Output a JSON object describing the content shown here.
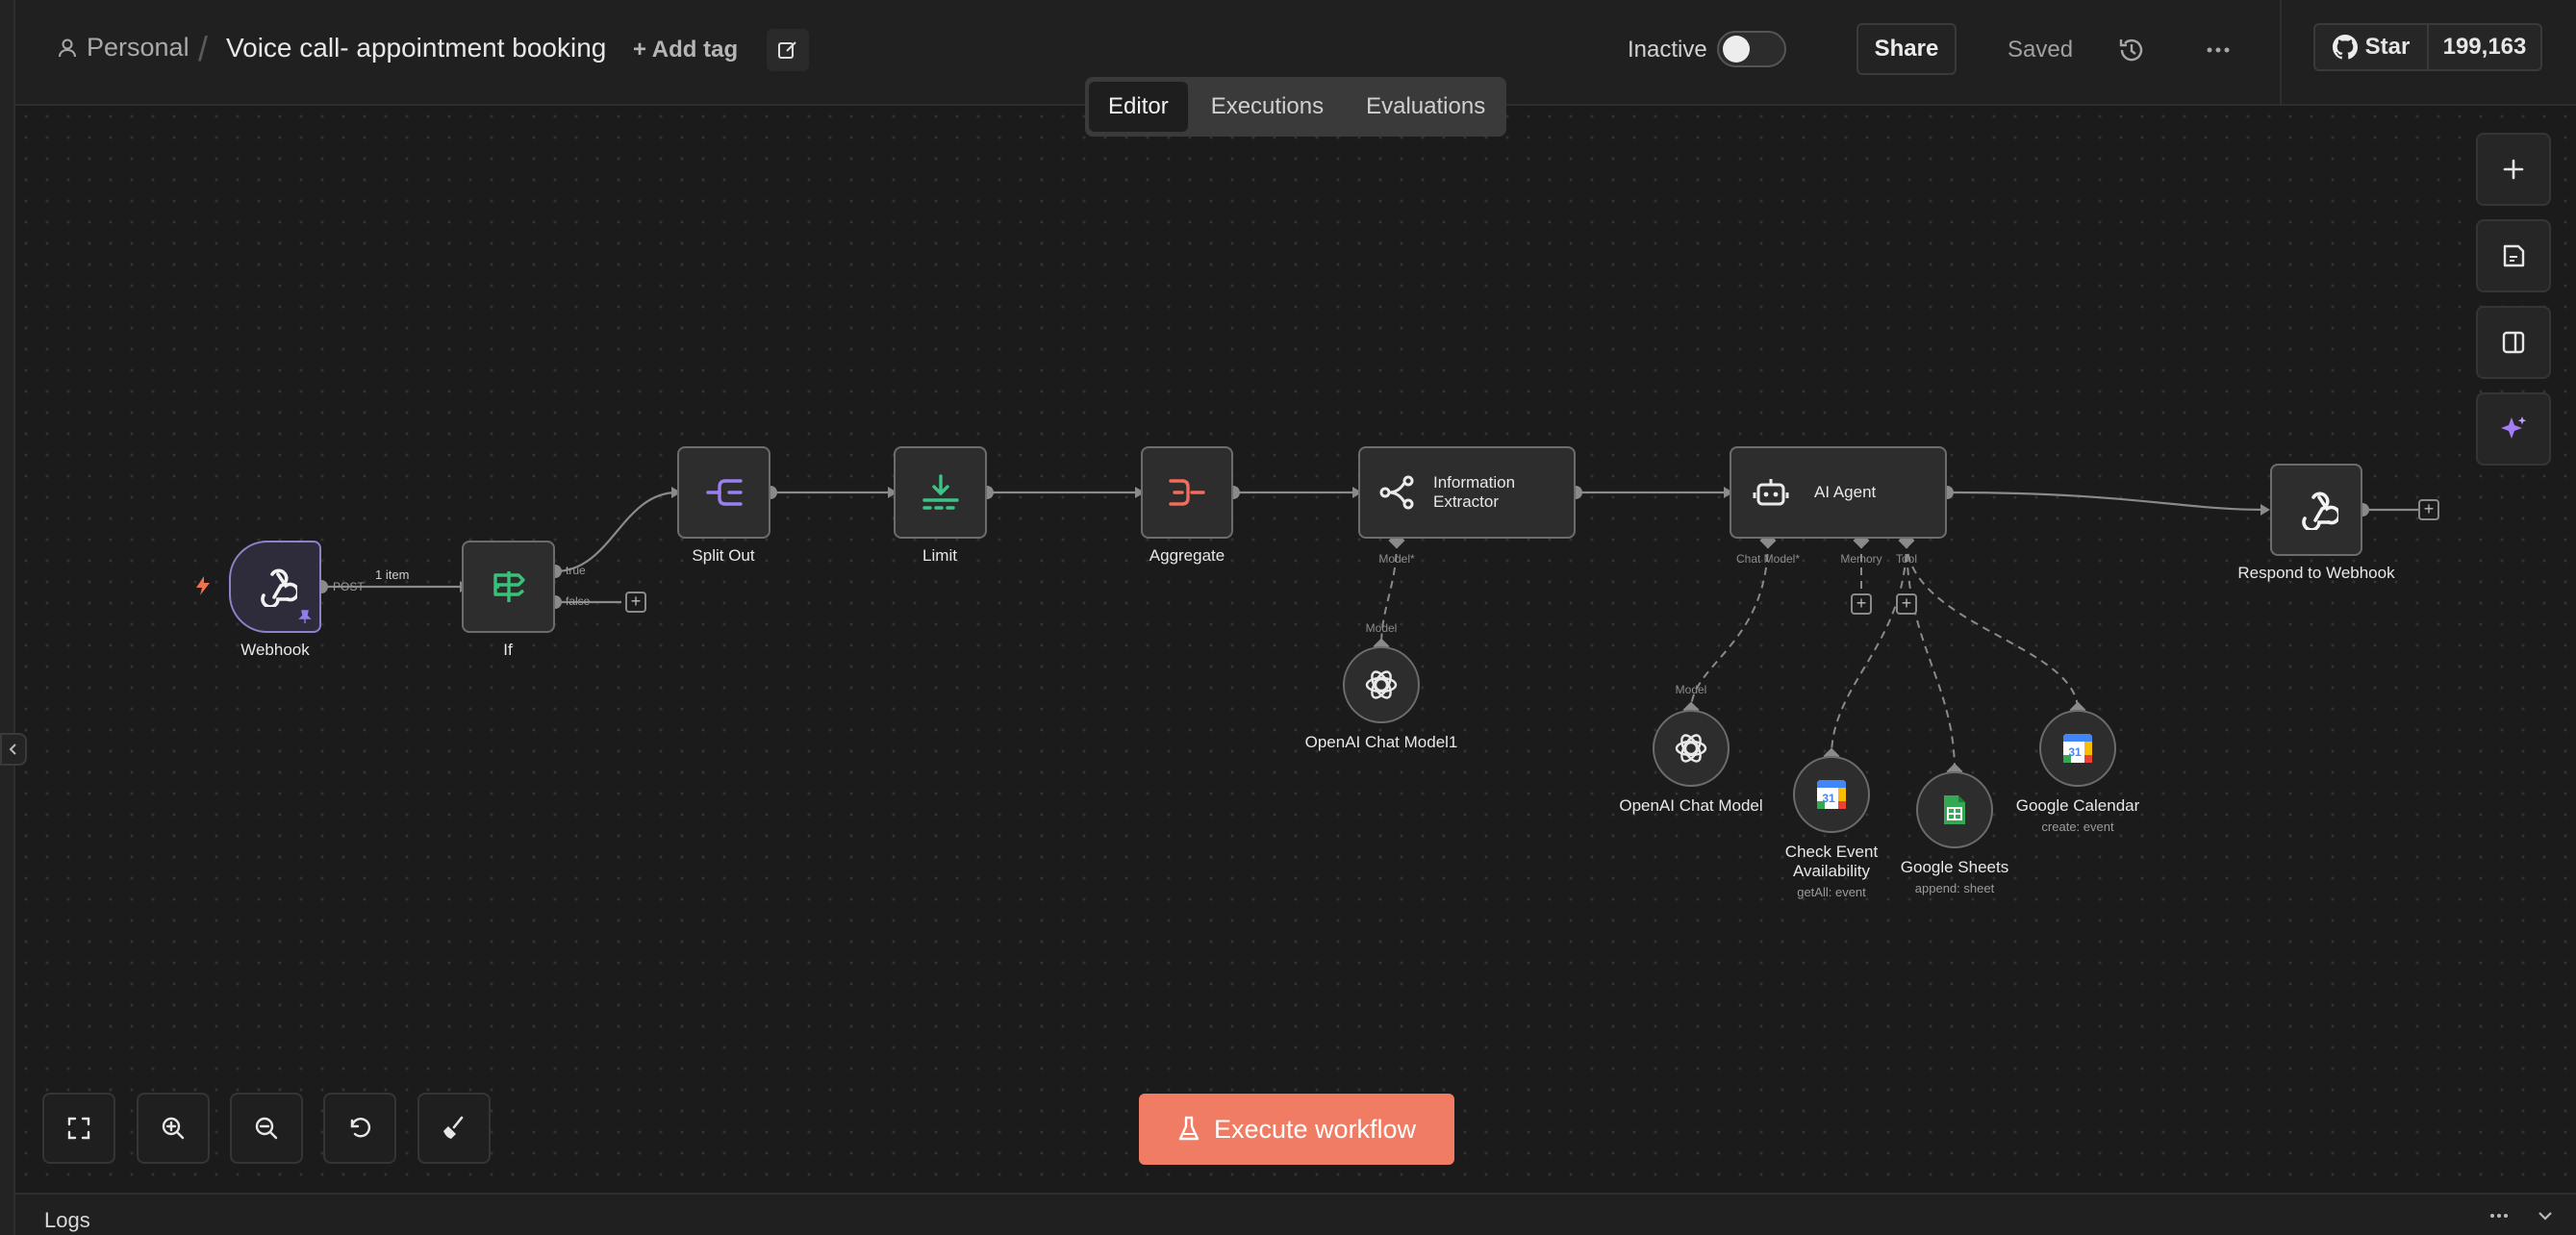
{
  "header": {
    "project": "Personal",
    "separator": "/",
    "workflow_title": "Voice call- appointment booking",
    "add_tag": "+ Add tag",
    "status_label": "Inactive",
    "share_label": "Share",
    "saved_label": "Saved",
    "github_star": "Star",
    "github_count": "199,163"
  },
  "tabs": [
    {
      "label": "Editor",
      "active": true
    },
    {
      "label": "Executions",
      "active": false
    },
    {
      "label": "Evaluations",
      "active": false
    }
  ],
  "nodes": {
    "webhook": {
      "label": "Webhook",
      "output": "POST",
      "items": "1 item"
    },
    "if": {
      "label": "If",
      "true": "true",
      "false": "false"
    },
    "split_out": {
      "label": "Split Out"
    },
    "limit": {
      "label": "Limit"
    },
    "aggregate": {
      "label": "Aggregate"
    },
    "information_extractor": {
      "label_line1": "Information",
      "label_line2": "Extractor",
      "port_model": "Model*"
    },
    "openai_chat_model1": {
      "label": "OpenAI Chat Model1",
      "port": "Model"
    },
    "ai_agent": {
      "label": "AI Agent",
      "port_chat_model": "Chat Model*",
      "port_memory": "Memory",
      "port_tool": "Tool"
    },
    "openai_chat_model": {
      "label": "OpenAI Chat Model",
      "port": "Model"
    },
    "check_event": {
      "label_line1": "Check Event",
      "label_line2": "Availability",
      "sub": "getAll: event"
    },
    "google_sheets": {
      "label": "Google Sheets",
      "sub": "append: sheet"
    },
    "google_calendar": {
      "label": "Google Calendar",
      "sub": "create: event"
    },
    "respond_webhook": {
      "label": "Respond to Webhook"
    }
  },
  "footer": {
    "execute_label": "Execute workflow",
    "logs_label": "Logs"
  },
  "colors": {
    "accent": "#f07c64",
    "split_out": "#9b7ff0",
    "limit": "#3ec488",
    "aggregate": "#f26b5b",
    "if": "#38c179",
    "trigger": "#8d83c9"
  }
}
